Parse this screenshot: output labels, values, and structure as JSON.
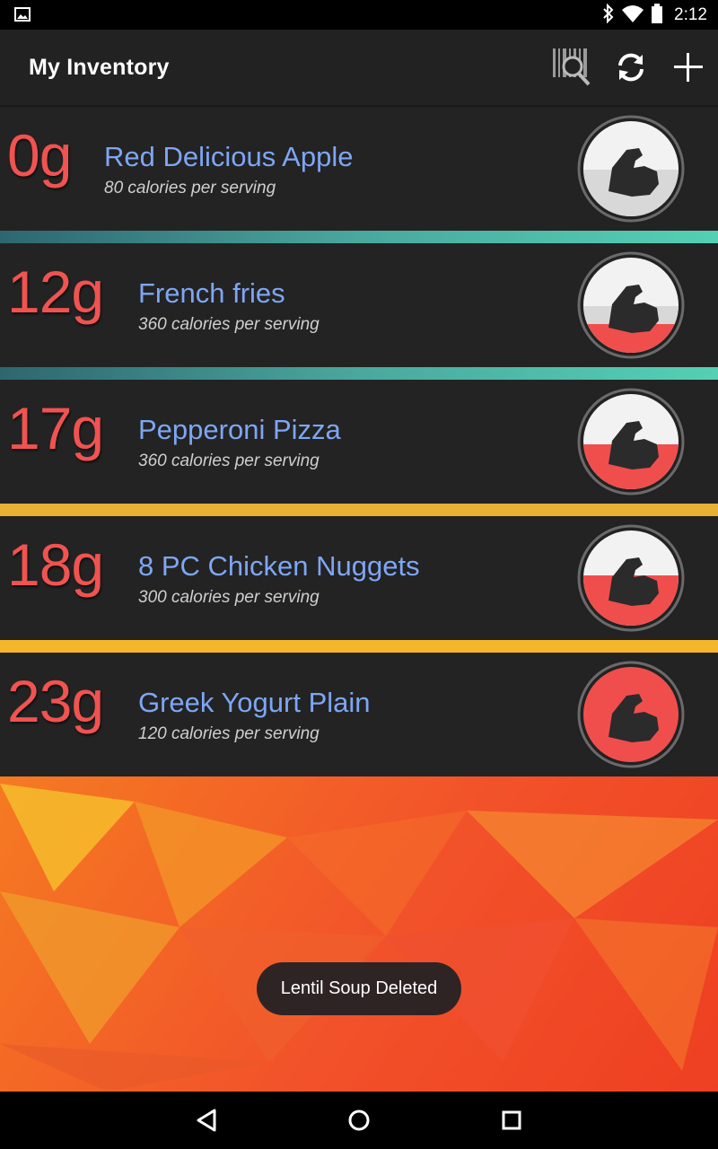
{
  "status_bar": {
    "time": "2:12",
    "icons": [
      "image-notification-icon",
      "bluetooth-icon",
      "wifi-icon",
      "battery-icon"
    ]
  },
  "action_bar": {
    "title": "My Inventory",
    "actions": [
      "barcode-search-icon",
      "refresh-icon",
      "add-icon"
    ]
  },
  "items": [
    {
      "amount": "0g",
      "name": "Red Delicious Apple",
      "calories": "80 calories per serving",
      "fill_fraction": 0.0
    },
    {
      "amount": "12g",
      "name": "French fries",
      "calories": "360 calories per serving",
      "fill_fraction": 0.35
    },
    {
      "amount": "17g",
      "name": "Pepperoni Pizza",
      "calories": "360 calories per serving",
      "fill_fraction": 0.5
    },
    {
      "amount": "18g",
      "name": "8 PC Chicken Nuggets",
      "calories": "300 calories per serving",
      "fill_fraction": 0.55
    },
    {
      "amount": "23g",
      "name": "Greek Yogurt Plain",
      "calories": "120 calories per serving",
      "fill_fraction": 1.0
    }
  ],
  "toast": {
    "text": "Lentil Soup Deleted"
  },
  "colors": {
    "accent_red": "#f05350",
    "item_name": "#7ea6f4",
    "row_bg": "#232323"
  },
  "nav_bar": [
    "back-icon",
    "home-icon",
    "recents-icon"
  ]
}
